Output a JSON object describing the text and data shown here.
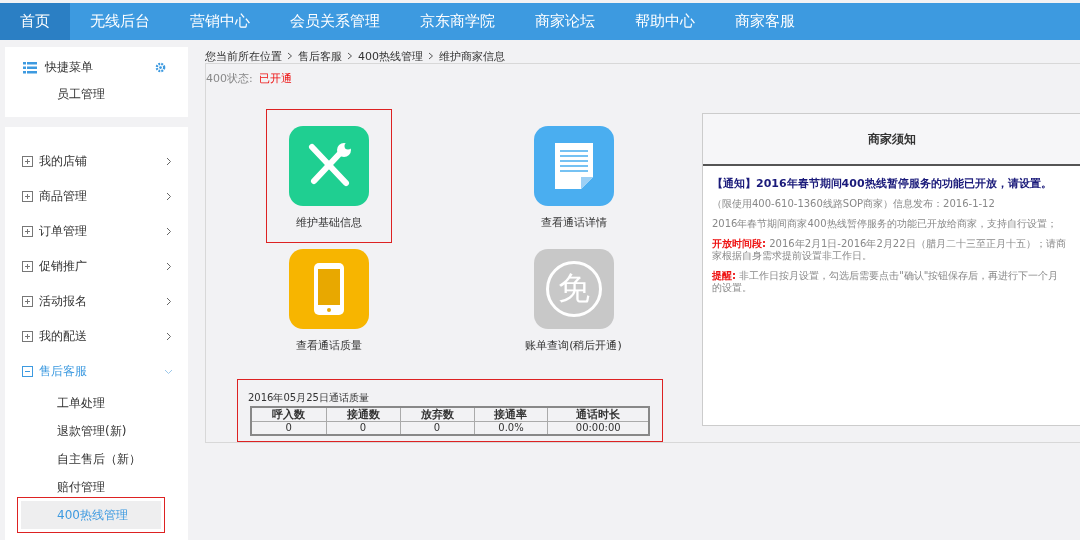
{
  "nav": [
    {
      "label": "首页",
      "selected": true
    },
    {
      "label": "无线后台",
      "selected": false
    },
    {
      "label": "营销中心",
      "selected": false
    },
    {
      "label": "会员关系管理",
      "selected": false
    },
    {
      "label": "京东商学院",
      "selected": false
    },
    {
      "label": "商家论坛",
      "selected": false
    },
    {
      "label": "帮助中心",
      "selected": false
    },
    {
      "label": "商家客服",
      "selected": false
    }
  ],
  "quick_menu": {
    "title": "快捷菜单",
    "items": [
      "员工管理"
    ]
  },
  "sidebar": {
    "items": [
      {
        "label": "我的店铺",
        "expanded": false
      },
      {
        "label": "商品管理",
        "expanded": false
      },
      {
        "label": "订单管理",
        "expanded": false
      },
      {
        "label": "促销推广",
        "expanded": false
      },
      {
        "label": "活动报名",
        "expanded": false
      },
      {
        "label": "我的配送",
        "expanded": false
      },
      {
        "label": "售后客服",
        "expanded": true,
        "children": [
          {
            "label": "工单处理",
            "selected": false,
            "highlighted": false
          },
          {
            "label": "退款管理(新)",
            "selected": false,
            "highlighted": false
          },
          {
            "label": "自主售后（新）",
            "selected": false,
            "highlighted": false
          },
          {
            "label": "赔付管理",
            "selected": false,
            "highlighted": false
          },
          {
            "label": "400热线管理",
            "selected": true,
            "highlighted": true
          }
        ]
      }
    ]
  },
  "breadcrumb": [
    "您当前所在位置",
    "售后客服",
    "400热线管理",
    "维护商家信息"
  ],
  "status": {
    "label": "400状态:",
    "value": "已开通"
  },
  "tile_rows": [
    {
      "tiles": [
        {
          "kind": "tools",
          "label": "维护基础信息",
          "highlighted": true
        },
        {
          "kind": "document",
          "label": "查看通话详情",
          "highlighted": false
        }
      ]
    },
    {
      "tiles": [
        {
          "kind": "phone",
          "label": "查看通话质量",
          "highlighted": false
        },
        {
          "kind": "free",
          "icon_text": "免",
          "label": "账单查询(稍后开通)",
          "highlighted": false
        }
      ]
    }
  ],
  "quality": {
    "title": "2016年05月25日通话质量",
    "highlighted": true,
    "columns": [
      "呼入数",
      "接通数",
      "放弃数",
      "接通率",
      "通话时长"
    ],
    "rows": [
      [
        "0",
        "0",
        "0",
        "0.0%",
        "00:00:00"
      ]
    ]
  },
  "notice": {
    "title": "商家须知",
    "items": [
      {
        "kind": "title",
        "text": "【通知】2016年春节期间400热线暂停服务的功能已开放，请设置。"
      },
      {
        "kind": "meta",
        "text": "（限使用400-610-1360线路SOP商家）信息发布：2016-1-12"
      },
      {
        "kind": "para",
        "text": "2016年春节期间商家400热线暂停服务的功能已开放给商家，支持自行设置；"
      },
      {
        "kind": "labeled",
        "label": "开放时间段:",
        "text": "2016年2月1日-2016年2月22日（腊月二十三至正月十五）；请商家根据自身需求提前设置非工作日。"
      },
      {
        "kind": "labeled",
        "label": "提醒:",
        "text": "非工作日按月设置，勾选后需要点击\"确认\"按钮保存后，再进行下一个月的设置。"
      }
    ]
  }
}
